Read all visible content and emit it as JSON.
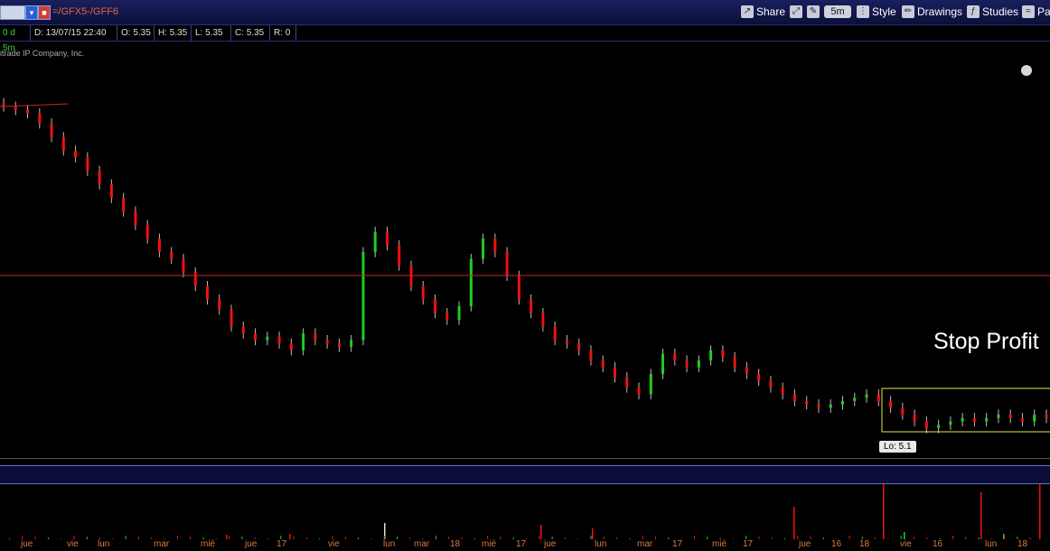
{
  "toolbar": {
    "symbol": "=/GFX5-/GFF6",
    "share_label": "Share",
    "timeframe_label": "5m",
    "style_label": "Style",
    "drawings_label": "Drawings",
    "studies_label": "Studies",
    "partial_label": "Pa"
  },
  "info": {
    "period": "0 d 5m",
    "date": "D: 13/07/15 22:40",
    "open": "O: 5.35",
    "high": "H: 5.35",
    "low": "L: 5.35",
    "close": "C: 5.35",
    "range": "R: 0"
  },
  "copyright": "itrade IP Company, Inc.",
  "annotations": {
    "stop_profit": "Stop Profit",
    "low_tag": "Lo: 5.1"
  },
  "colors": {
    "up": "#22cc22",
    "down": "#ee1111",
    "hline": "#cc2222",
    "box": "#e8e84a",
    "axis_text": "#d77b3a"
  },
  "x_ticks": [
    "jue",
    "vie",
    "lun",
    "mar",
    "mié",
    "jue",
    "17",
    "vie",
    "lun",
    "mar",
    "18",
    "mié",
    "17",
    "jue",
    "lun",
    "mar",
    "17",
    "mié",
    "17",
    "jue",
    "16",
    "18",
    "vie",
    "16",
    "lun",
    "18"
  ],
  "chart_data": {
    "type": "candlestick",
    "y_reference_line": 5.35,
    "low": 5.1,
    "closes": [
      6.05,
      6.04,
      6.03,
      6.0,
      5.96,
      5.92,
      5.9,
      5.86,
      5.82,
      5.78,
      5.74,
      5.7,
      5.66,
      5.62,
      5.6,
      5.56,
      5.52,
      5.48,
      5.45,
      5.4,
      5.38,
      5.36,
      5.37,
      5.35,
      5.33,
      5.38,
      5.36,
      5.35,
      5.34,
      5.36,
      5.62,
      5.68,
      5.64,
      5.58,
      5.52,
      5.48,
      5.44,
      5.42,
      5.46,
      5.6,
      5.66,
      5.62,
      5.55,
      5.48,
      5.44,
      5.4,
      5.36,
      5.35,
      5.33,
      5.3,
      5.28,
      5.25,
      5.22,
      5.2,
      5.26,
      5.32,
      5.3,
      5.28,
      5.3,
      5.33,
      5.31,
      5.28,
      5.26,
      5.24,
      5.22,
      5.2,
      5.18,
      5.17,
      5.16,
      5.17,
      5.18,
      5.19,
      5.2,
      5.18,
      5.16,
      5.14,
      5.12,
      5.1,
      5.11,
      5.12,
      5.13,
      5.12,
      5.13,
      5.14,
      5.13,
      5.12,
      5.14,
      5.13
    ]
  }
}
